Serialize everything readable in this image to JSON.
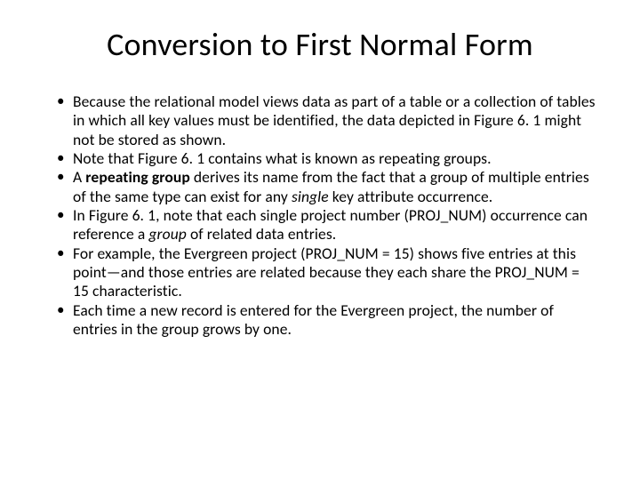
{
  "slide": {
    "title": "Conversion to First Normal Form",
    "bullets": [
      {
        "parts": [
          {
            "text": "Because the relational model views data as part of a table or a collection of tables in which all key values must be identified, the data depicted in Figure 6. 1 might not be stored as shown."
          }
        ]
      },
      {
        "parts": [
          {
            "text": "Note that Figure 6. 1 contains what is known as repeating groups."
          }
        ]
      },
      {
        "parts": [
          {
            "text": "A "
          },
          {
            "text": "repeating group",
            "bold": true
          },
          {
            "text": " derives its name from the fact that a group of multiple entries of the same type can exist for any "
          },
          {
            "text": "single",
            "italic": true
          },
          {
            "text": " key attribute occurrence."
          }
        ]
      },
      {
        "parts": [
          {
            "text": "In Figure 6. 1, note that each single project number (PROJ_NUM) occurrence can reference a "
          },
          {
            "text": "group",
            "italic": true
          },
          {
            "text": " of related data entries."
          }
        ]
      },
      {
        "parts": [
          {
            "text": "For example, the Evergreen project (PROJ_NUM = 15) shows five entries at this point—and those entries are related because they each share the PROJ_NUM = 15 characteristic."
          }
        ]
      },
      {
        "parts": [
          {
            "text": "Each time a new record is entered for the Evergreen project, the number of entries in the group grows by one."
          }
        ]
      }
    ]
  }
}
